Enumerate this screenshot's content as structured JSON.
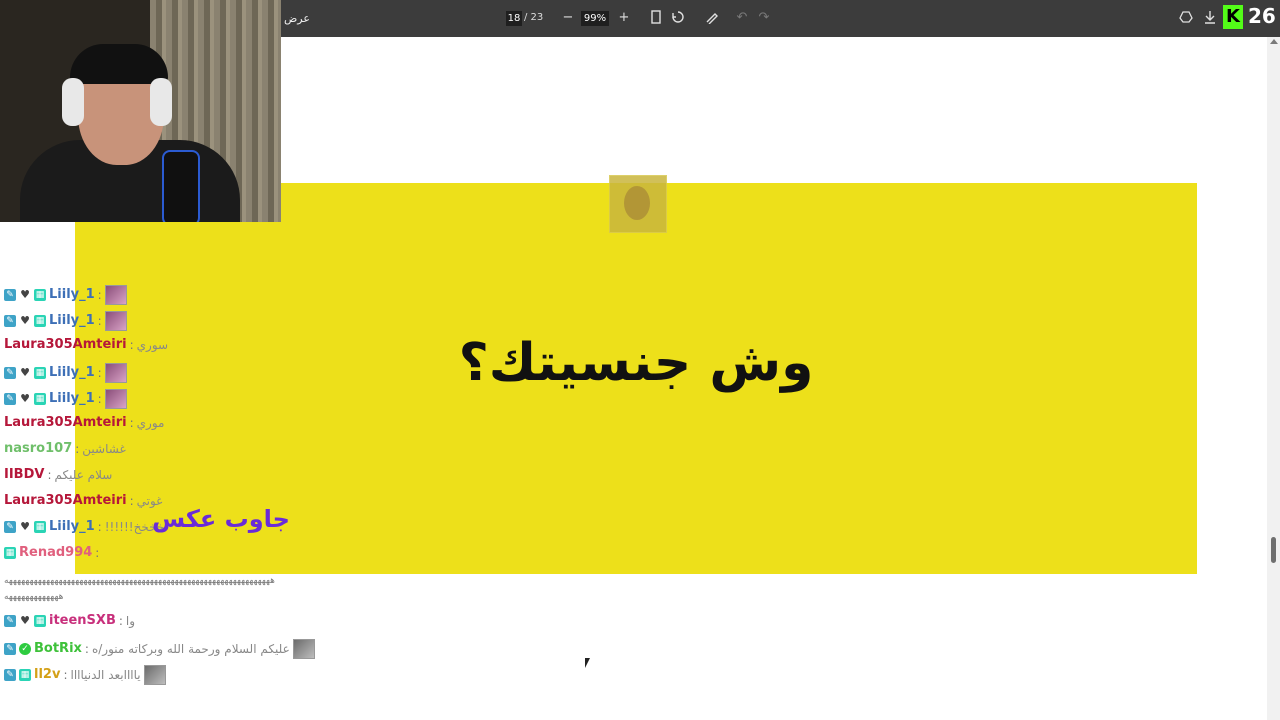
{
  "toolbar": {
    "title": "عرض",
    "page_current": "18",
    "page_total": "/ 23",
    "zoom": "99%",
    "zoom_out_glyph": "−",
    "zoom_in_glyph": "+",
    "fit_icon": "fit-page-icon",
    "rotate_icon": "rotate-icon",
    "draw_icon": "draw-icon",
    "undo_icon": "undo-icon",
    "redo_icon": "redo-icon",
    "drive_icon": "drive-icon",
    "download_icon": "download-icon"
  },
  "kick": {
    "logo": "K",
    "viewer_count": "26",
    "color": "#53fc18"
  },
  "slide": {
    "question": "وش جنسيتك؟",
    "background": "#ede01a"
  },
  "overlay": {
    "purple_text": "جاوب عكس",
    "color": "#6a2bd8"
  },
  "chat": {
    "messages": [
      {
        "user": "Liily_1",
        "color": "#3d6fb6",
        "text": "",
        "emote": true
      },
      {
        "user": "Liily_1",
        "color": "#3d6fb6",
        "text": "",
        "emote": true
      },
      {
        "user": "Laura305Amteiri",
        "color": "#b5173a",
        "text": "سوري",
        "emote": false
      },
      {
        "user": "Liily_1",
        "color": "#3d6fb6",
        "text": "",
        "emote": true
      },
      {
        "user": "Liily_1",
        "color": "#3d6fb6",
        "text": "",
        "emote": true
      },
      {
        "user": "Laura305Amteiri",
        "color": "#b5173a",
        "text": "موري",
        "emote": false
      },
      {
        "user": "nasro107",
        "color": "#6fbf6a",
        "text": "غشاشين",
        "emote": false
      },
      {
        "user": "IIBDV",
        "color": "#b5173a",
        "text": "سلام عليكم",
        "emote": false
      },
      {
        "user": "Laura305Amteiri",
        "color": "#b5173a",
        "text": "غوتي",
        "emote": false
      },
      {
        "user": "Liily_1",
        "color": "#3d6fb6",
        "text": "!!!!!!خخخخ",
        "emote": false
      },
      {
        "user": "Renad994",
        "color": "#e0607e",
        "text": "",
        "emote": false
      },
      {
        "user": "iteenSXB",
        "color": "#c8307c",
        "text": "وا",
        "emote": false
      },
      {
        "user": "BotRix",
        "color": "#3ec13a",
        "text": "عليكم السلام ورحمة الله وبركاته منور/ه",
        "emote": true
      },
      {
        "user": "ll2v",
        "color": "#d4a017",
        "text": "ياااابعد الدنياااا",
        "emote": true
      }
    ],
    "long_line_1": "ههههههههههههههههههههههههههههههههههههههههههههههههههههههههههههههههه",
    "long_line_2": "هههههههههههههه"
  }
}
